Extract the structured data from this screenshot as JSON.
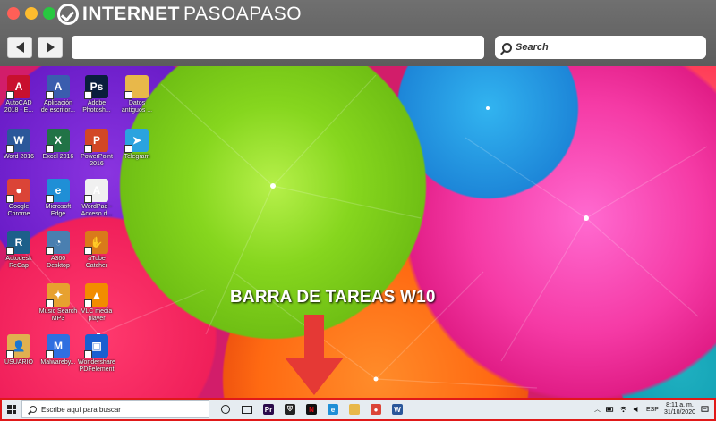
{
  "browser": {
    "logo_main": "INTERNET",
    "logo_accent": "PASOAPASO",
    "search_label": "Search"
  },
  "desktop": {
    "caption": "BARRA DE TAREAS W10",
    "icons": [
      {
        "label": "AutoCAD\n2018 - E...",
        "icon": "autocad-icon",
        "color": "#c8102e",
        "glyph": "A"
      },
      {
        "label": "Aplicación\nde escritor...",
        "icon": "autodesk-app-icon",
        "color": "#3a5dae",
        "glyph": "A"
      },
      {
        "label": "Adobe\nPhotosh...",
        "icon": "photoshop-icon",
        "color": "#0a1e3c",
        "glyph": "Ps"
      },
      {
        "label": "Datos\nantiguos ...",
        "icon": "folder-icon",
        "color": "#e8b84a",
        "glyph": ""
      },
      {
        "label": "Word 2016",
        "icon": "word-icon",
        "color": "#2b579a",
        "glyph": "W"
      },
      {
        "label": "Excel 2016",
        "icon": "excel-icon",
        "color": "#217346",
        "glyph": "X"
      },
      {
        "label": "PowerPoint\n2016",
        "icon": "powerpoint-icon",
        "color": "#d24726",
        "glyph": "P"
      },
      {
        "label": "Telegram",
        "icon": "telegram-icon",
        "color": "#2aa3df",
        "glyph": "➤"
      },
      {
        "label": "Google\nChrome",
        "icon": "chrome-icon",
        "color": "#db4437",
        "glyph": "●"
      },
      {
        "label": "Microsoft\nEdge",
        "icon": "edge-icon",
        "color": "#1f8fd6",
        "glyph": "e"
      },
      {
        "label": "WordPad -\nAcceso d...",
        "icon": "wordpad-icon",
        "color": "#f0f0f0",
        "glyph": "A"
      },
      {
        "label": "Autodesk\nReCap",
        "icon": "recap-icon",
        "color": "#1d5f8a",
        "glyph": "R"
      },
      {
        "label": "A360\nDesktop",
        "icon": "a360-icon",
        "color": "#4a7fb0",
        "glyph": "◔"
      },
      {
        "label": "aTube\nCatcher",
        "icon": "atube-icon",
        "color": "#d97a1a",
        "glyph": "✋"
      },
      {
        "label": "Music Search\nMP3",
        "icon": "music-search-icon",
        "color": "#e7a12f",
        "glyph": "✦"
      },
      {
        "label": "VLC media\nplayer",
        "icon": "vlc-icon",
        "color": "#f28c00",
        "glyph": "▲"
      },
      {
        "label": "USUARIO",
        "icon": "user-folder-icon",
        "color": "#e0b050",
        "glyph": "👤"
      },
      {
        "label": "Malwareby...",
        "icon": "malwarebytes-icon",
        "color": "#2f6fe0",
        "glyph": "M"
      },
      {
        "label": "Wondershare\nPDFelement",
        "icon": "pdfelement-icon",
        "color": "#1a5fd0",
        "glyph": "▣"
      }
    ]
  },
  "taskbar": {
    "search_placeholder": "Escribe aquí para buscar",
    "language": "ESP",
    "time": "8:11 a. m.",
    "date": "31/10/2020",
    "apps": [
      {
        "icon": "cortana-icon"
      },
      {
        "icon": "task-view-icon"
      },
      {
        "icon": "premiere-icon",
        "color": "#2a0a4a",
        "glyph": "Pr"
      },
      {
        "icon": "shield-icon",
        "color": "#222",
        "glyph": "⛨"
      },
      {
        "icon": "netflix-icon",
        "color": "#111",
        "glyph": "N"
      },
      {
        "icon": "edge-icon",
        "color": "#1f8fd6",
        "glyph": "e"
      },
      {
        "icon": "file-explorer-icon",
        "color": "#e8b84a",
        "glyph": ""
      },
      {
        "icon": "chrome-icon",
        "color": "#db4437",
        "glyph": "●"
      },
      {
        "icon": "word-icon",
        "color": "#2b579a",
        "glyph": "W"
      }
    ]
  }
}
